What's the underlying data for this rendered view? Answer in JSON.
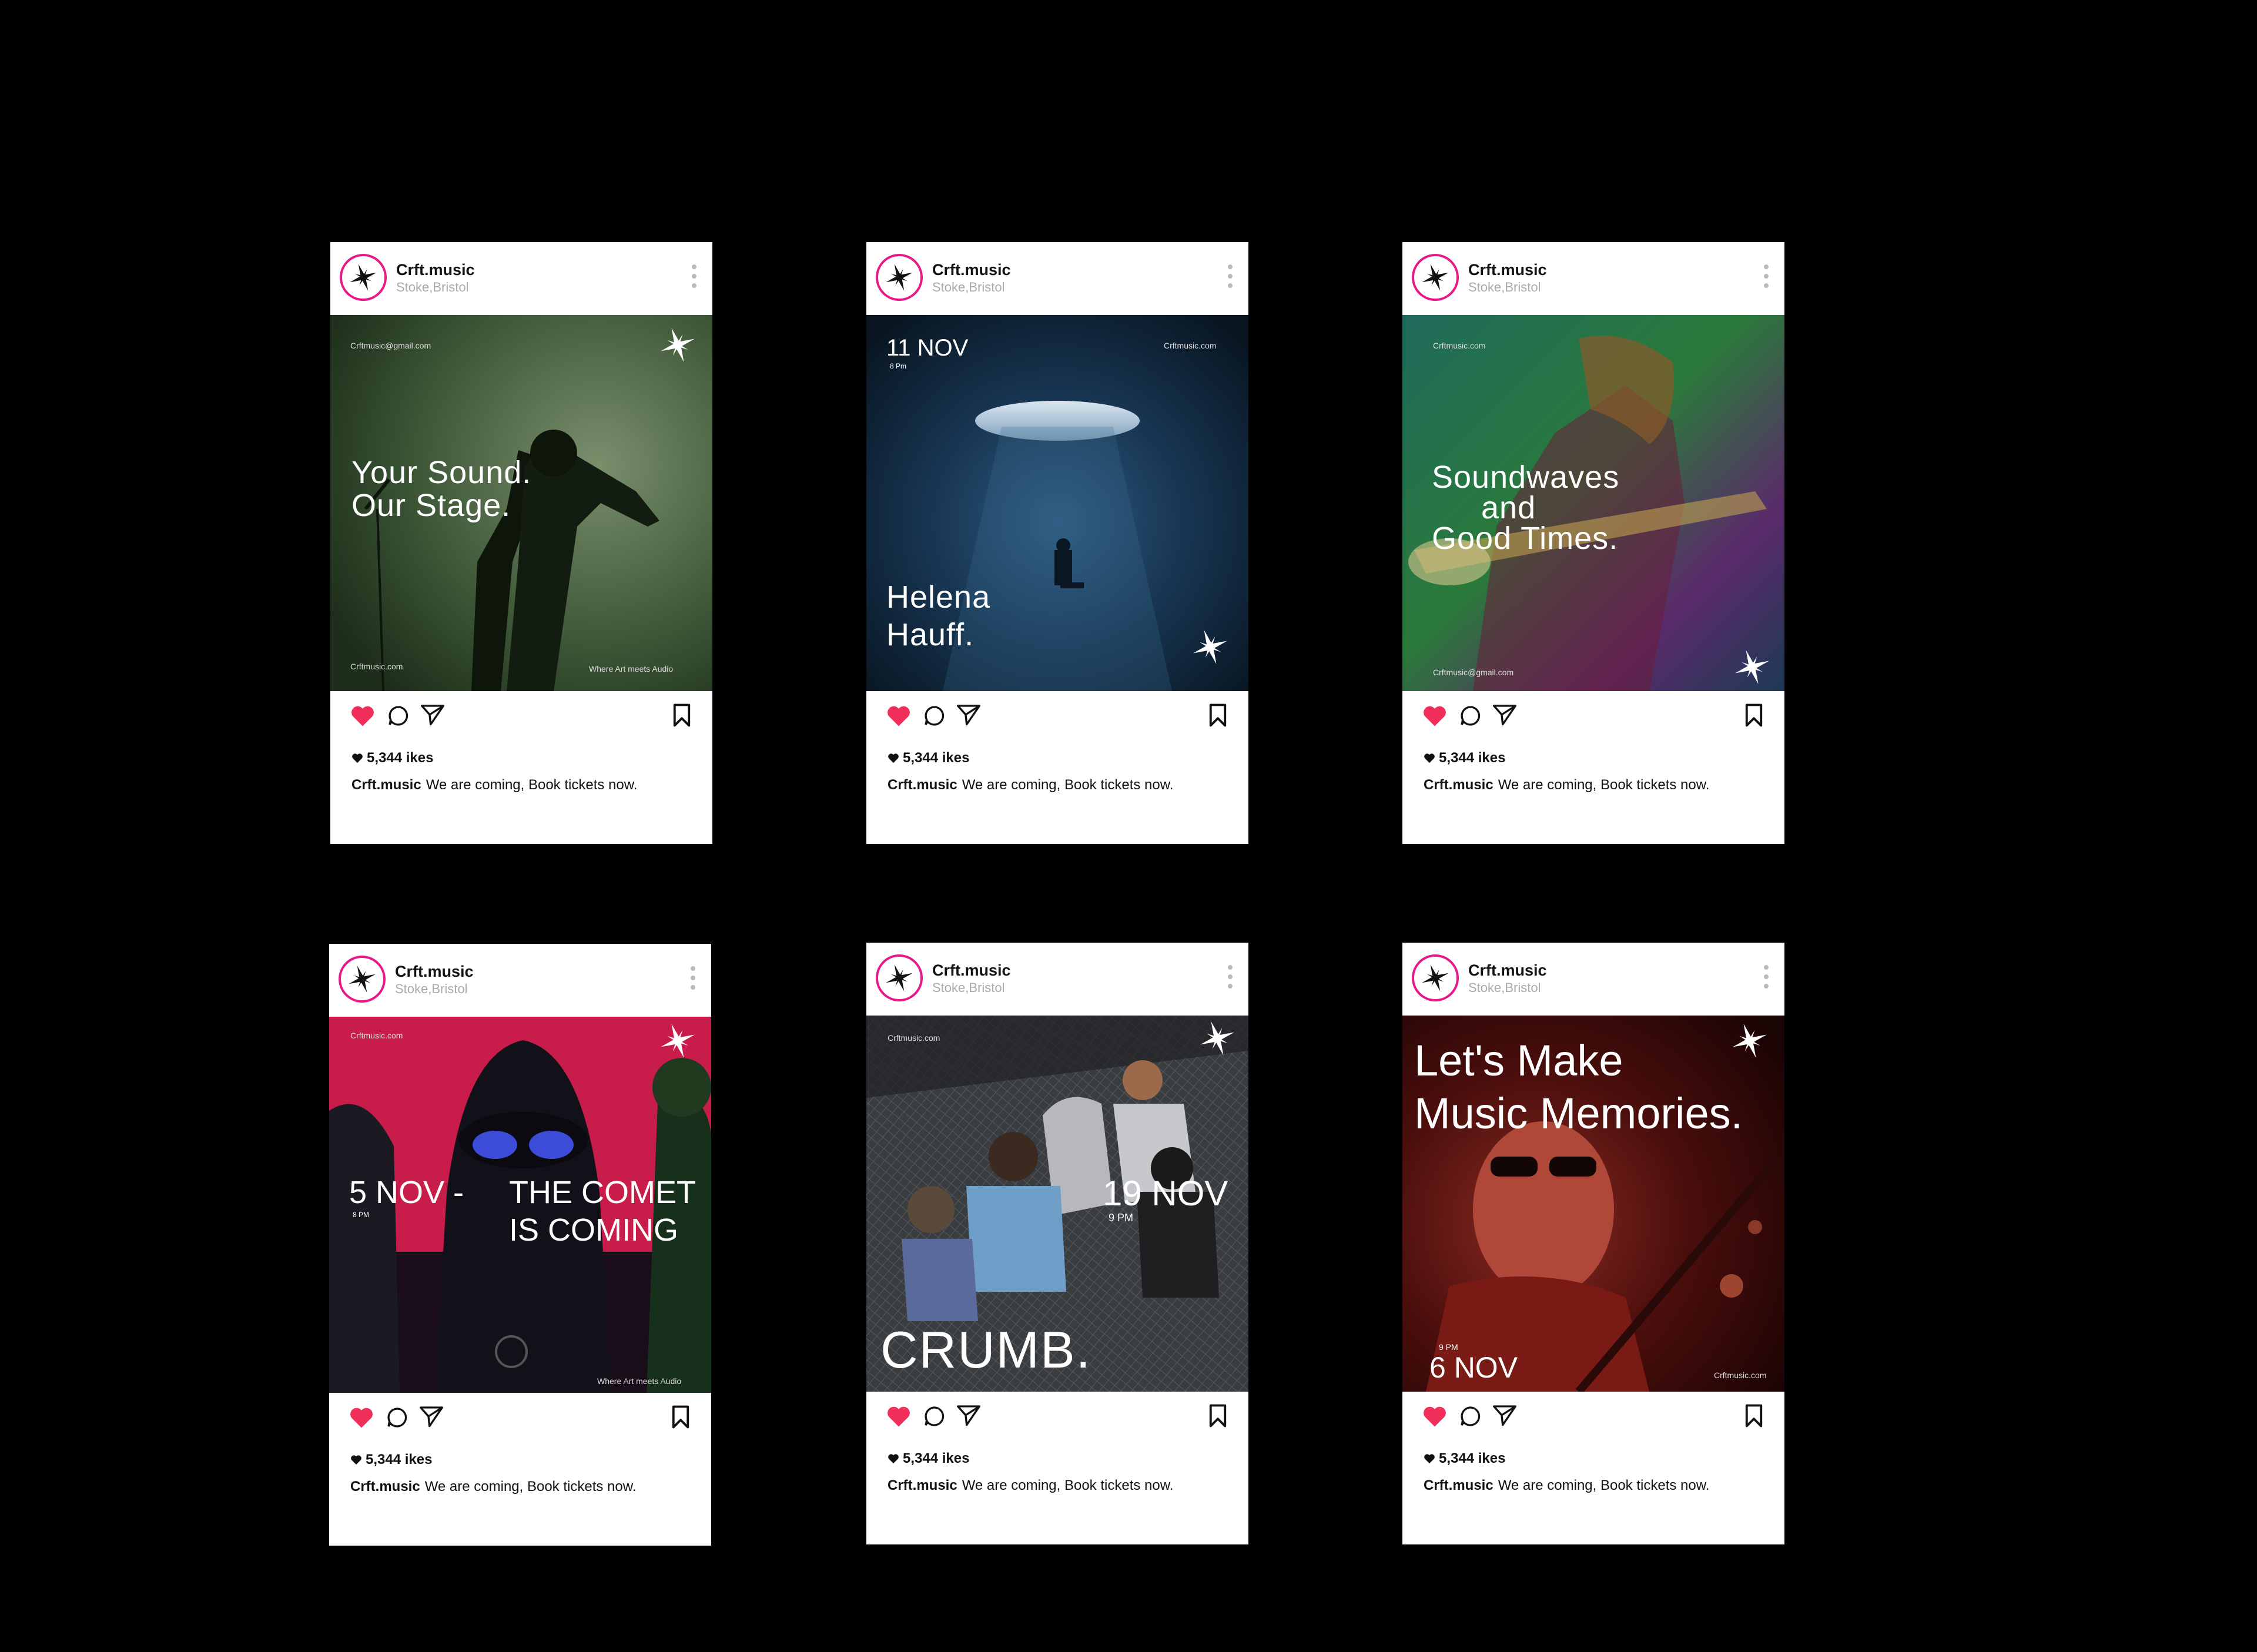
{
  "account": {
    "name": "Crft.music",
    "location": "Stoke,Bristol"
  },
  "colors": {
    "accent": "#e8178a",
    "heart": "#f0305a",
    "background": "#000000"
  },
  "posts": [
    {
      "email_or_site_top": "Crftmusic@gmail.com",
      "headline": [
        "Your Sound.",
        "Our Stage."
      ],
      "footer_left": "Crftmusic.com",
      "footer_right": "Where Art meets Audio",
      "likes": "5,344 ikes",
      "caption_user": "Crft.music",
      "caption_text": "We are coming, Book tickets now."
    },
    {
      "date": "11 NOV",
      "time": "8 Pm",
      "site": "Crftmusic.com",
      "headline": [
        "Helena",
        "Hauff."
      ],
      "likes": "5,344 ikes",
      "caption_user": "Crft.music",
      "caption_text": "We are coming, Book tickets now."
    },
    {
      "site": "Crftmusic.com",
      "headline": [
        "Soundwaves",
        "and",
        "Good Times."
      ],
      "footer_left": "Crftmusic@gmail.com",
      "likes": "5,344 ikes",
      "caption_user": "Crft.music",
      "caption_text": "We are coming, Book tickets now."
    },
    {
      "site": "Crftmusic.com",
      "date": "5 NOV -",
      "time": "8 PM",
      "headline": [
        "THE COMET",
        "IS COMING"
      ],
      "footer_right": "Where Art meets Audio",
      "likes": "5,344 ikes",
      "caption_user": "Crft.music",
      "caption_text": "We are coming, Book tickets now."
    },
    {
      "site": "Crftmusic.com",
      "date": "19 NOV",
      "time": "9 PM",
      "headline": [
        "CRUMB."
      ],
      "likes": "5,344 ikes",
      "caption_user": "Crft.music",
      "caption_text": "We are coming, Book tickets now."
    },
    {
      "headline": [
        "Let's Make",
        "Music Memories."
      ],
      "time": "9 PM",
      "date": "6 NOV",
      "site": "Crftmusic.com",
      "likes": "5,344 ikes",
      "caption_user": "Crft.music",
      "caption_text": "We are coming, Book tickets now."
    }
  ]
}
